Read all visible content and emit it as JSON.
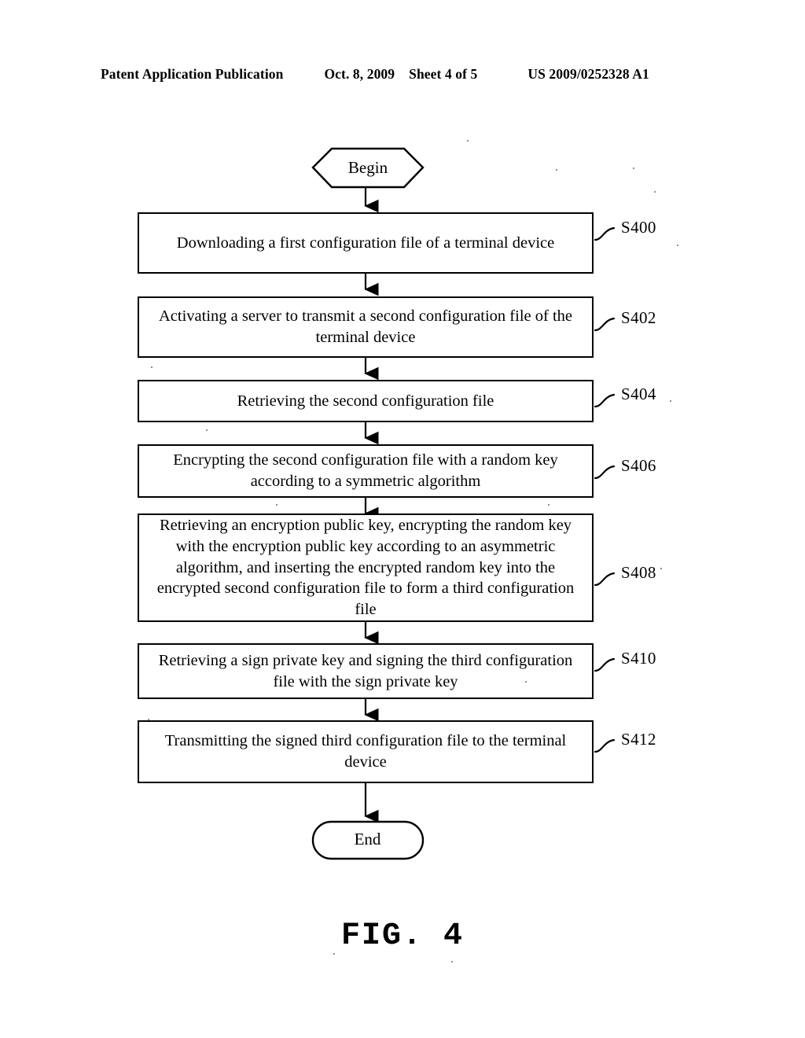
{
  "header": {
    "publication": "Patent Application Publication",
    "date": "Oct. 8, 2009",
    "sheet": "Sheet 4 of 5",
    "patent_number": "US 2009/0252328 A1"
  },
  "figure": {
    "caption": "FIG. 4",
    "type": "flowchart",
    "stroke_color": "#000000",
    "fill_color": "#ffffff"
  },
  "flowchart": {
    "start_label": "Begin",
    "end_label": "End",
    "steps": [
      {
        "ref": "S400",
        "text": "Downloading a first configuration file of a terminal device"
      },
      {
        "ref": "S402",
        "text": "Activating a server to transmit a second configuration file of the terminal device"
      },
      {
        "ref": "S404",
        "text": "Retrieving the second configuration file"
      },
      {
        "ref": "S406",
        "text": "Encrypting the second configuration file with a random key according to a symmetric algorithm"
      },
      {
        "ref": "S408",
        "text": "Retrieving an encryption public key, encrypting the random key with the encryption public key according to an asymmetric algorithm, and inserting the encrypted random key into the encrypted second configuration file to form a third configuration file"
      },
      {
        "ref": "S410",
        "text": "Retrieving a sign private key and signing the third configuration file with the sign private key"
      },
      {
        "ref": "S412",
        "text": "Transmitting the signed third configuration file to the terminal device"
      }
    ]
  }
}
